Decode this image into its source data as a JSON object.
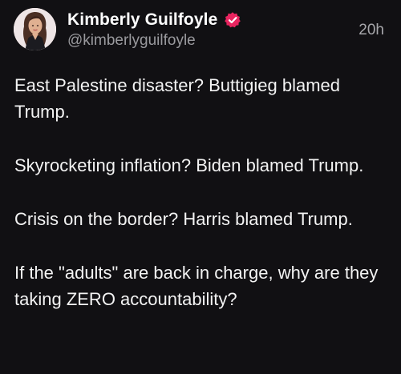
{
  "author": {
    "display_name": "Kimberly Guilfoyle",
    "handle": "@kimberlyguilfoyle",
    "avatar_icon": "profile-photo",
    "verified_icon": "verified-badge-icon",
    "verified_color": "#e0245e"
  },
  "post": {
    "timestamp": "20h",
    "paragraphs": [
      "East Palestine disaster? Buttigieg blamed Trump.",
      "Skyrocketing inflation? Biden blamed Trump.",
      "Crisis on the border? Harris blamed Trump.",
      "If the \"adults\" are back in charge, why are they taking ZERO accountability?"
    ]
  },
  "theme": {
    "background": "#111013",
    "text": "#f3f3f3",
    "secondary_text": "#9a9a9e"
  }
}
